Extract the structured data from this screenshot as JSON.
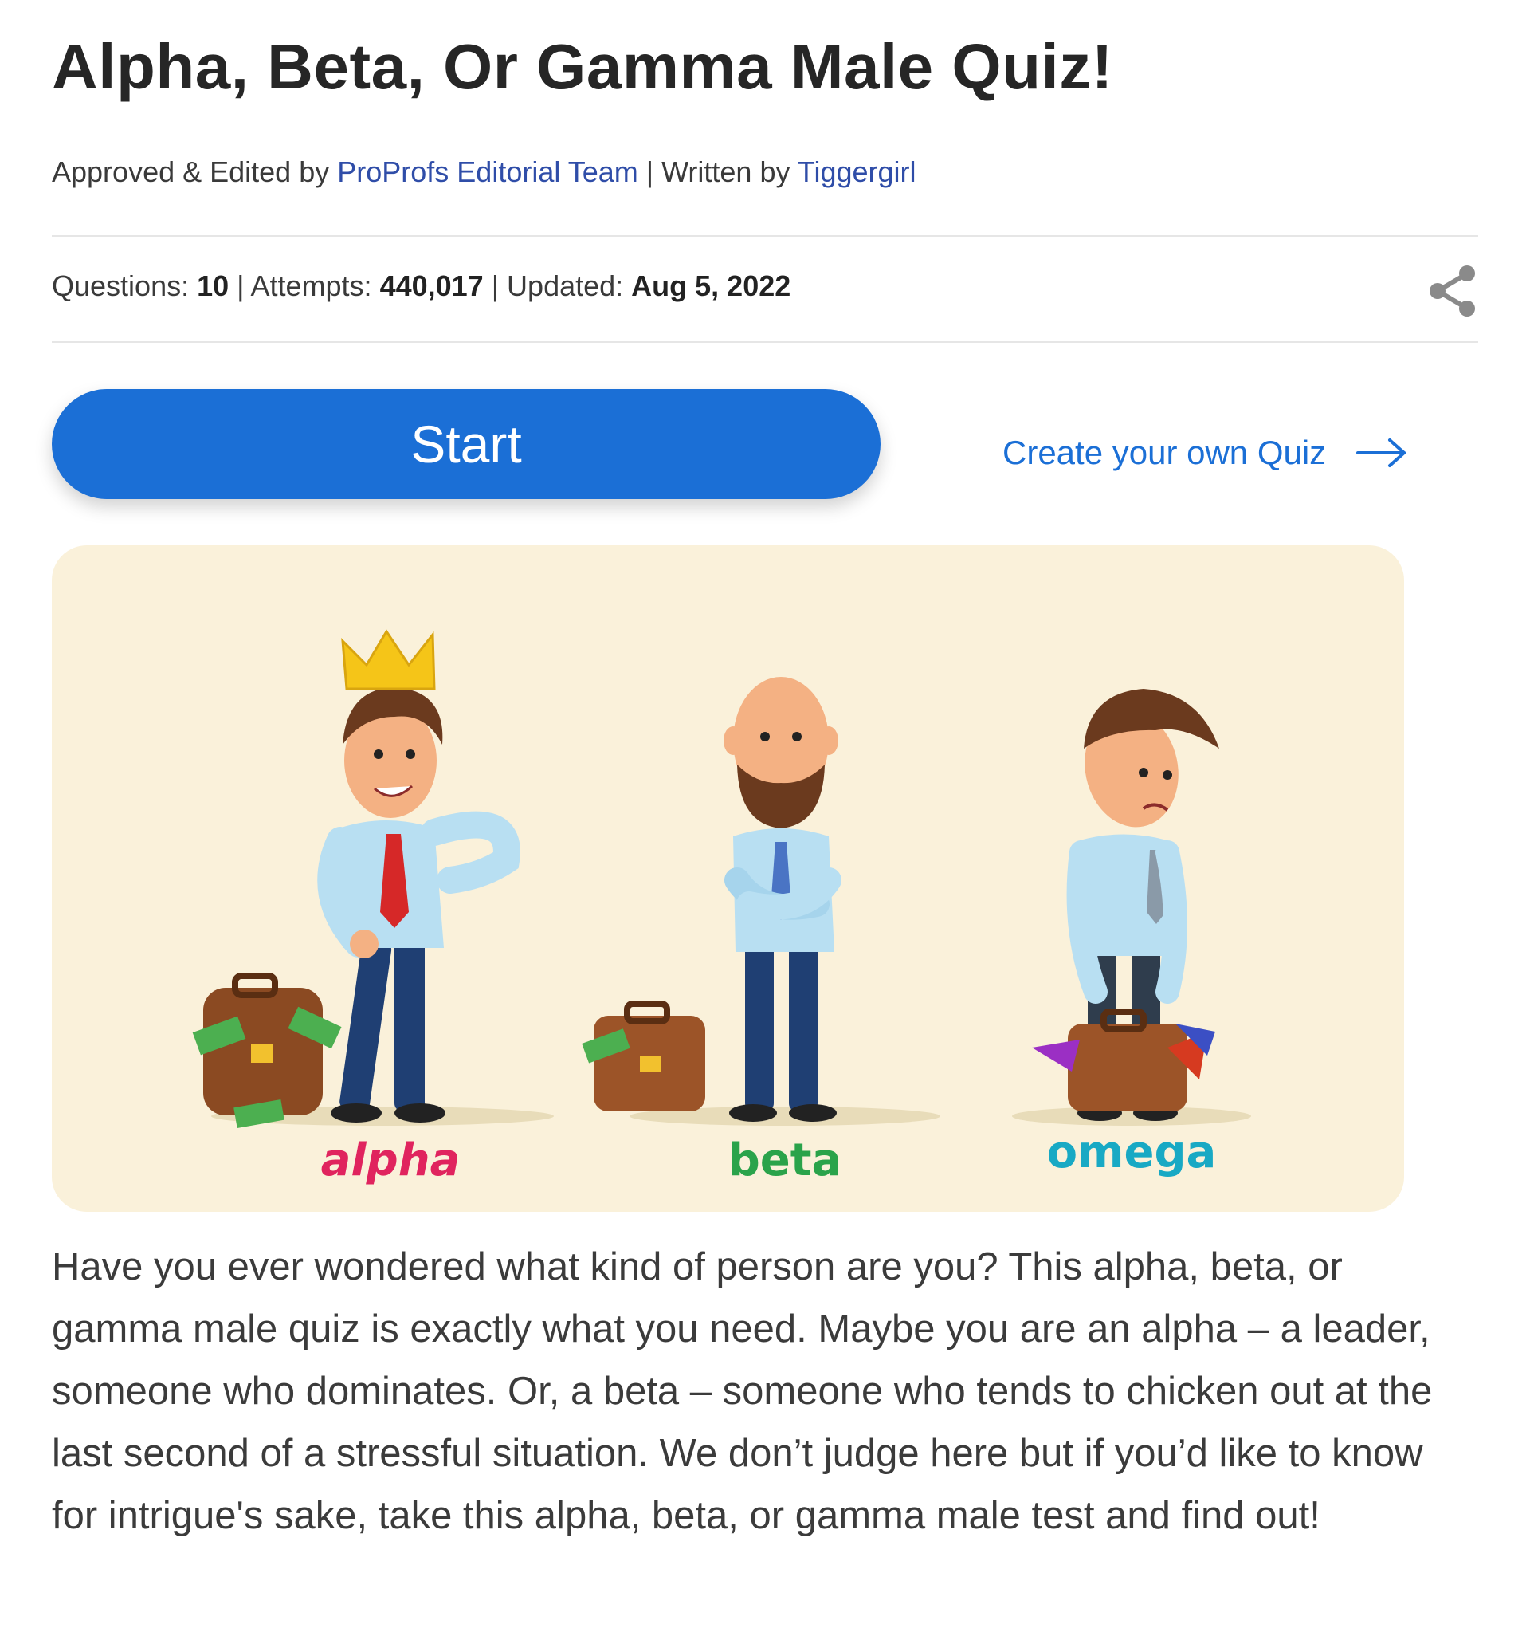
{
  "title": "Alpha, Beta, Or Gamma Male Quiz!",
  "byline": {
    "approved_prefix": "Approved & Edited by ",
    "approved_by": "ProProfs Editorial Team",
    "written_prefix": " | Written by ",
    "written_by": "Tiggergirl"
  },
  "stats": {
    "questions_label": "Questions: ",
    "questions_value": "10",
    "attempts_label": " | Attempts: ",
    "attempts_value": "440,017",
    "updated_label": " | Updated: ",
    "updated_value": "Aug 5, 2022"
  },
  "share_icon": "share-icon",
  "start_label": "Start",
  "create_quiz_label": "Create your own Quiz",
  "hero": {
    "labels": [
      "alpha",
      "beta",
      "omega"
    ],
    "label_colors": [
      "#e0245e",
      "#2aa34a",
      "#18a9c4"
    ],
    "background": "#faf1da"
  },
  "description": "Have you ever wondered what kind of person are you? This alpha, beta, or gamma male quiz is exactly what you need. Maybe you are an alpha – a leader, someone who dominates. Or, a beta – someone who tends to chicken out at the last second of a stressful situation. We don’t judge here but if you’d like to know for intrigue's sake, take this alpha, beta, or gamma male test and find out!",
  "colors": {
    "accent": "#1b6fd6",
    "link": "#2f4da8"
  }
}
